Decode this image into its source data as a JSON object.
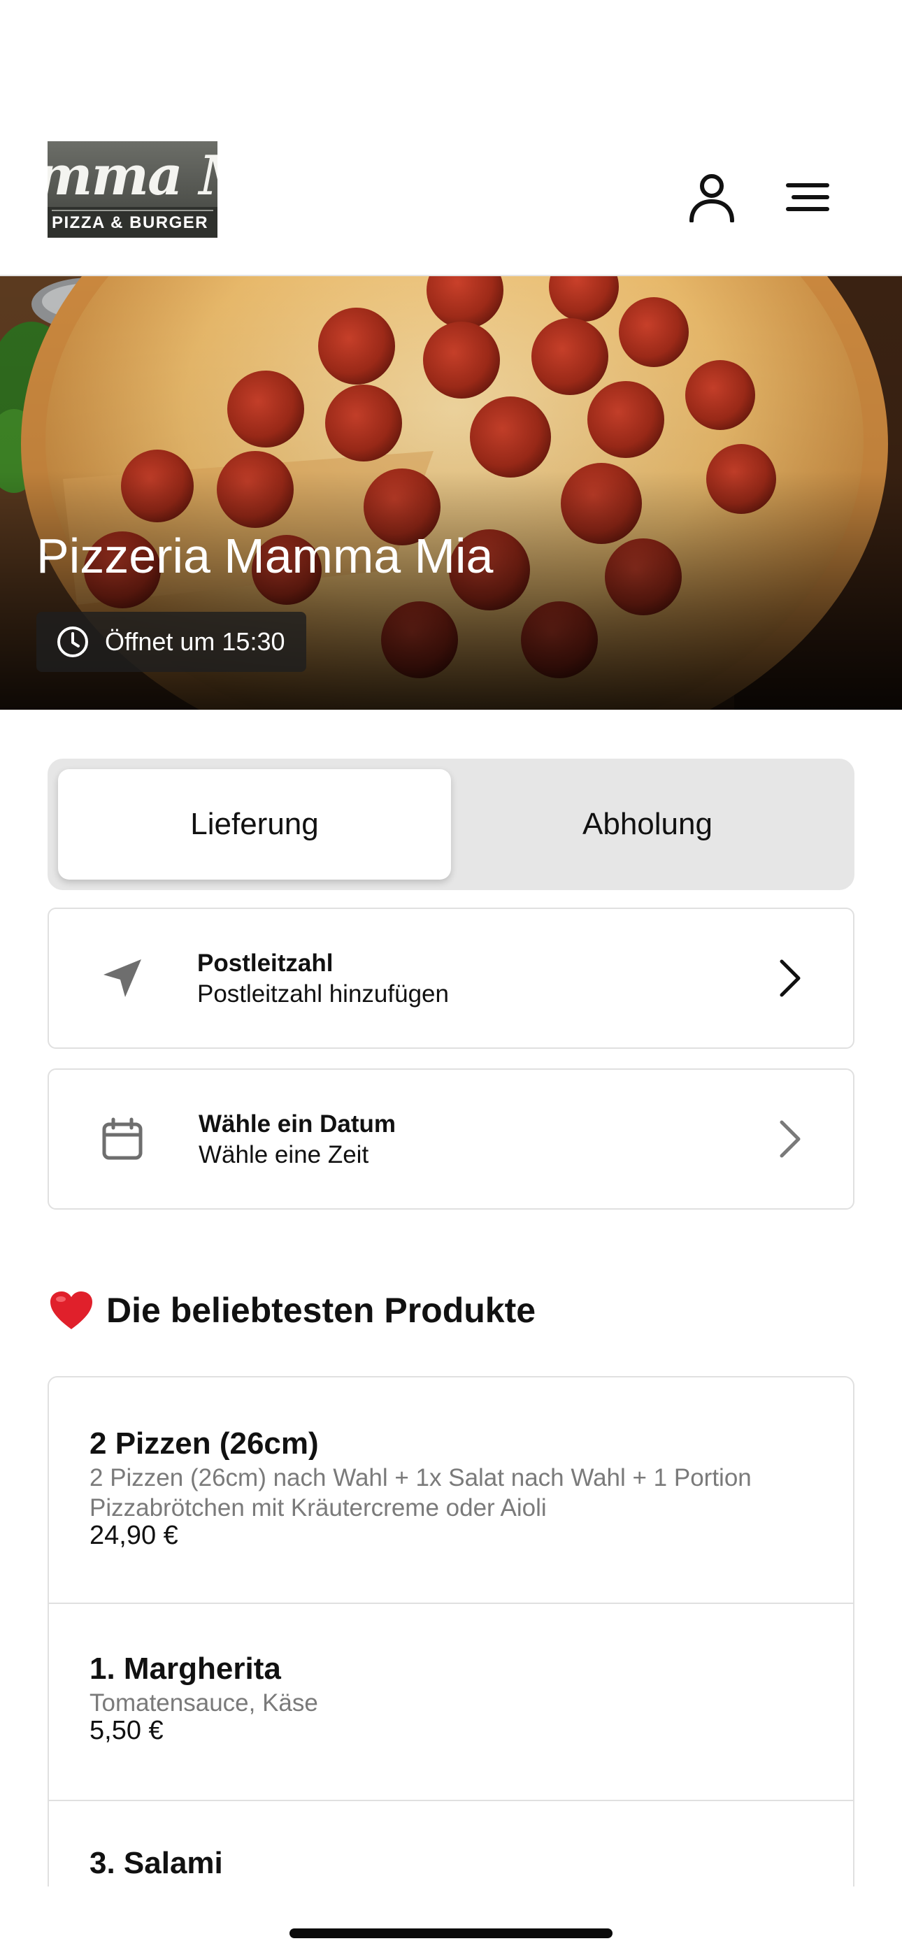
{
  "header": {
    "logo_script": "mma Mi",
    "logo_subtitle": "PIZZA & BURGER",
    "account_icon": "user-icon",
    "menu_icon": "hamburger-menu-icon"
  },
  "hero": {
    "title": "Pizzeria Mamma Mia",
    "hours_icon": "clock-icon",
    "hours": "Öffnet um 15:30"
  },
  "order_mode": {
    "options": [
      "Lieferung",
      "Abholung"
    ],
    "selected": "Lieferung"
  },
  "postcode": {
    "icon": "navigation-arrow-icon",
    "title": "Postleitzahl",
    "subtitle": "Postleitzahl hinzufügen"
  },
  "schedule": {
    "icon": "calendar-icon",
    "title": "Wähle ein Datum",
    "subtitle": "Wähle eine Zeit"
  },
  "popular": {
    "icon": "heart-icon",
    "title": "Die beliebtesten Produkte",
    "products": [
      {
        "name": "2 Pizzen (26cm)",
        "description": "2 Pizzen (26cm) nach Wahl + 1x Salat nach Wahl + 1 Portion Pizzabrötchen mit Kräutercreme oder Aioli",
        "price": "24,90 €"
      },
      {
        "name": "1. Margherita",
        "description": "Tomatensauce, Käse",
        "price": "5,50 €"
      },
      {
        "name": "3. Salami",
        "description": "",
        "price": ""
      }
    ]
  },
  "colors": {
    "accent_heart": "#e0202b",
    "toggle_bg": "#e6e6e6",
    "border": "#e0e0e0",
    "muted_text": "#7a7a7a"
  }
}
